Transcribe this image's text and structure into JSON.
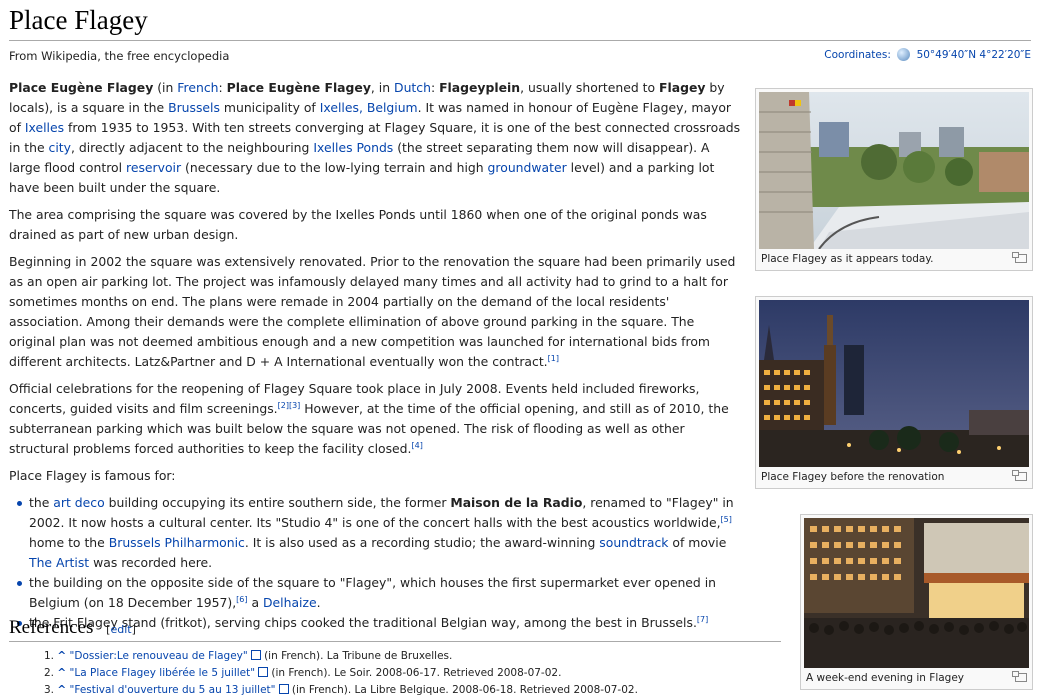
{
  "page": {
    "title": "Place Flagey",
    "subtitle": "From Wikipedia, the free encyclopedia",
    "coords_label": "Coordinates:",
    "coords_value": "50°49′40″N 4°22′20″E"
  },
  "body": {
    "p1": {
      "a": "Place Eugène Flagey",
      "b": " (in ",
      "french": "French",
      "c": ": ",
      "d": "Place Eugène Flagey",
      "e": ", in ",
      "dutch": "Dutch",
      "f": ": ",
      "g": "Flageyplein",
      "h": ", usually shortened to ",
      "i": "Flagey",
      "j": " by locals), is a square in the ",
      "brussels": "Brussels",
      "k": " municipality of ",
      "ixelles_belgium": "Ixelles, Belgium",
      "l": ". It was named in honour of Eugène Flagey, mayor of ",
      "ixelles": "Ixelles",
      "m": " from 1935 to 1953. With ten streets converging at Flagey Square, it is one of the best connected crossroads in the ",
      "city": "city",
      "n": ", directly adjacent to the neighbouring ",
      "ixelles_ponds": "Ixelles Ponds",
      "o": " (the street separating them now will disappear). A large flood control ",
      "reservoir": "reservoir",
      "p": " (necessary due to the low-lying terrain and high ",
      "groundwater": "groundwater",
      "q": " level) and a parking lot have been built under the square."
    },
    "p2": "The area comprising the square was covered by the Ixelles Ponds until 1860 when one of the original ponds was drained as part of new urban design.",
    "p3": "Beginning in 2002 the square was extensively renovated. Prior to the renovation the square had been primarily used as an open air parking lot. The project was infamously delayed many times and all activity had to grind to a halt for sometimes months on end. The plans were remade in 2004 partially on the demand of the local residents' association. Among their demands were the complete ellimination of above ground parking in the square. The original plan was not deemed ambitious enough and a new competition was launched for international bids from different architects. Latz&Partner and D + A International eventually won the contract.",
    "p3_ref": "[1]",
    "p4a": "Official celebrations for the reopening of Flagey Square took place in July 2008. Events held included fireworks, concerts, guided visits and film screenings.",
    "p4_ref1": "[2]",
    "p4_ref2": "[3]",
    "p4b": " However, at the time of the official opening, and still as of 2010, the subterranean parking which was built below the square was not opened. The risk of flooding as well as other structural problems forced authorities to keep the facility closed.",
    "p4_ref3": "[4]",
    "p5": "Place Flagey is famous for:",
    "li1": {
      "a": "the ",
      "art_deco": "art deco",
      "b": " building occupying its entire southern side, the former ",
      "maison": "Maison de la Radio",
      "c": ", renamed to \"Flagey\" in 2002. It now hosts a cultural center. Its \"Studio 4\" is one of the concert halls with the best acoustics worldwide,",
      "ref5": "[5]",
      "d": " home to the ",
      "phil": "Brussels Philharmonic",
      "e": ". It is also used as a recording studio; the award-winning ",
      "soundtrack": "soundtrack",
      "f": " of movie ",
      "artist": "The Artist",
      "g": " was recorded here."
    },
    "li2": {
      "a": "the building on the opposite side of the square to \"Flagey\", which houses the first supermarket ever opened in Belgium (on 18 December 1957),",
      "ref6": "[6]",
      "b": " a ",
      "delhaize": "Delhaize",
      "c": "."
    },
    "li3": {
      "a": "the Frit Flagey stand (fritkot), serving chips cooked the traditional Belgian way, among the best in Brussels.",
      "ref7": "[7]"
    }
  },
  "references": {
    "heading": "References",
    "edit": "[edit]",
    "items": [
      {
        "num": "1.",
        "caret": "^",
        "link": "\"Dossier:Le renouveau de Flagey\"",
        "rest": " (in French). La Tribune de Bruxelles."
      },
      {
        "num": "2.",
        "caret": "^",
        "link": "\"La Place Flagey libérée le 5 juillet\"",
        "rest": " (in French). Le Soir. 2008-06-17. Retrieved 2008-07-02."
      },
      {
        "num": "3.",
        "caret": "^",
        "link": "\"Festival d'ouverture du 5 au 13 juillet\"",
        "rest": " (in French). La Libre Belgique. 2008-06-18. Retrieved 2008-07-02."
      }
    ]
  },
  "thumbs": [
    {
      "caption": "Place Flagey as it appears today."
    },
    {
      "caption": "Place Flagey before the renovation"
    },
    {
      "caption": "A week-end evening in Flagey"
    }
  ]
}
